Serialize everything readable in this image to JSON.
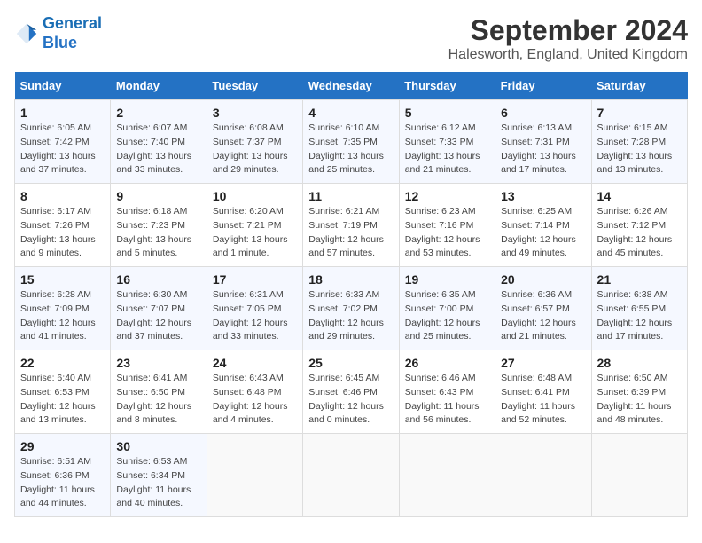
{
  "header": {
    "logo_line1": "General",
    "logo_line2": "Blue",
    "month": "September 2024",
    "location": "Halesworth, England, United Kingdom"
  },
  "days_of_week": [
    "Sunday",
    "Monday",
    "Tuesday",
    "Wednesday",
    "Thursday",
    "Friday",
    "Saturday"
  ],
  "weeks": [
    [
      {
        "day": "1",
        "sunrise": "6:05 AM",
        "sunset": "7:42 PM",
        "daylight": "13 hours and 37 minutes."
      },
      {
        "day": "2",
        "sunrise": "6:07 AM",
        "sunset": "7:40 PM",
        "daylight": "13 hours and 33 minutes."
      },
      {
        "day": "3",
        "sunrise": "6:08 AM",
        "sunset": "7:37 PM",
        "daylight": "13 hours and 29 minutes."
      },
      {
        "day": "4",
        "sunrise": "6:10 AM",
        "sunset": "7:35 PM",
        "daylight": "13 hours and 25 minutes."
      },
      {
        "day": "5",
        "sunrise": "6:12 AM",
        "sunset": "7:33 PM",
        "daylight": "13 hours and 21 minutes."
      },
      {
        "day": "6",
        "sunrise": "6:13 AM",
        "sunset": "7:31 PM",
        "daylight": "13 hours and 17 minutes."
      },
      {
        "day": "7",
        "sunrise": "6:15 AM",
        "sunset": "7:28 PM",
        "daylight": "13 hours and 13 minutes."
      }
    ],
    [
      {
        "day": "8",
        "sunrise": "6:17 AM",
        "sunset": "7:26 PM",
        "daylight": "13 hours and 9 minutes."
      },
      {
        "day": "9",
        "sunrise": "6:18 AM",
        "sunset": "7:23 PM",
        "daylight": "13 hours and 5 minutes."
      },
      {
        "day": "10",
        "sunrise": "6:20 AM",
        "sunset": "7:21 PM",
        "daylight": "13 hours and 1 minute."
      },
      {
        "day": "11",
        "sunrise": "6:21 AM",
        "sunset": "7:19 PM",
        "daylight": "12 hours and 57 minutes."
      },
      {
        "day": "12",
        "sunrise": "6:23 AM",
        "sunset": "7:16 PM",
        "daylight": "12 hours and 53 minutes."
      },
      {
        "day": "13",
        "sunrise": "6:25 AM",
        "sunset": "7:14 PM",
        "daylight": "12 hours and 49 minutes."
      },
      {
        "day": "14",
        "sunrise": "6:26 AM",
        "sunset": "7:12 PM",
        "daylight": "12 hours and 45 minutes."
      }
    ],
    [
      {
        "day": "15",
        "sunrise": "6:28 AM",
        "sunset": "7:09 PM",
        "daylight": "12 hours and 41 minutes."
      },
      {
        "day": "16",
        "sunrise": "6:30 AM",
        "sunset": "7:07 PM",
        "daylight": "12 hours and 37 minutes."
      },
      {
        "day": "17",
        "sunrise": "6:31 AM",
        "sunset": "7:05 PM",
        "daylight": "12 hours and 33 minutes."
      },
      {
        "day": "18",
        "sunrise": "6:33 AM",
        "sunset": "7:02 PM",
        "daylight": "12 hours and 29 minutes."
      },
      {
        "day": "19",
        "sunrise": "6:35 AM",
        "sunset": "7:00 PM",
        "daylight": "12 hours and 25 minutes."
      },
      {
        "day": "20",
        "sunrise": "6:36 AM",
        "sunset": "6:57 PM",
        "daylight": "12 hours and 21 minutes."
      },
      {
        "day": "21",
        "sunrise": "6:38 AM",
        "sunset": "6:55 PM",
        "daylight": "12 hours and 17 minutes."
      }
    ],
    [
      {
        "day": "22",
        "sunrise": "6:40 AM",
        "sunset": "6:53 PM",
        "daylight": "12 hours and 13 minutes."
      },
      {
        "day": "23",
        "sunrise": "6:41 AM",
        "sunset": "6:50 PM",
        "daylight": "12 hours and 8 minutes."
      },
      {
        "day": "24",
        "sunrise": "6:43 AM",
        "sunset": "6:48 PM",
        "daylight": "12 hours and 4 minutes."
      },
      {
        "day": "25",
        "sunrise": "6:45 AM",
        "sunset": "6:46 PM",
        "daylight": "12 hours and 0 minutes."
      },
      {
        "day": "26",
        "sunrise": "6:46 AM",
        "sunset": "6:43 PM",
        "daylight": "11 hours and 56 minutes."
      },
      {
        "day": "27",
        "sunrise": "6:48 AM",
        "sunset": "6:41 PM",
        "daylight": "11 hours and 52 minutes."
      },
      {
        "day": "28",
        "sunrise": "6:50 AM",
        "sunset": "6:39 PM",
        "daylight": "11 hours and 48 minutes."
      }
    ],
    [
      {
        "day": "29",
        "sunrise": "6:51 AM",
        "sunset": "6:36 PM",
        "daylight": "11 hours and 44 minutes."
      },
      {
        "day": "30",
        "sunrise": "6:53 AM",
        "sunset": "6:34 PM",
        "daylight": "11 hours and 40 minutes."
      },
      null,
      null,
      null,
      null,
      null
    ]
  ]
}
